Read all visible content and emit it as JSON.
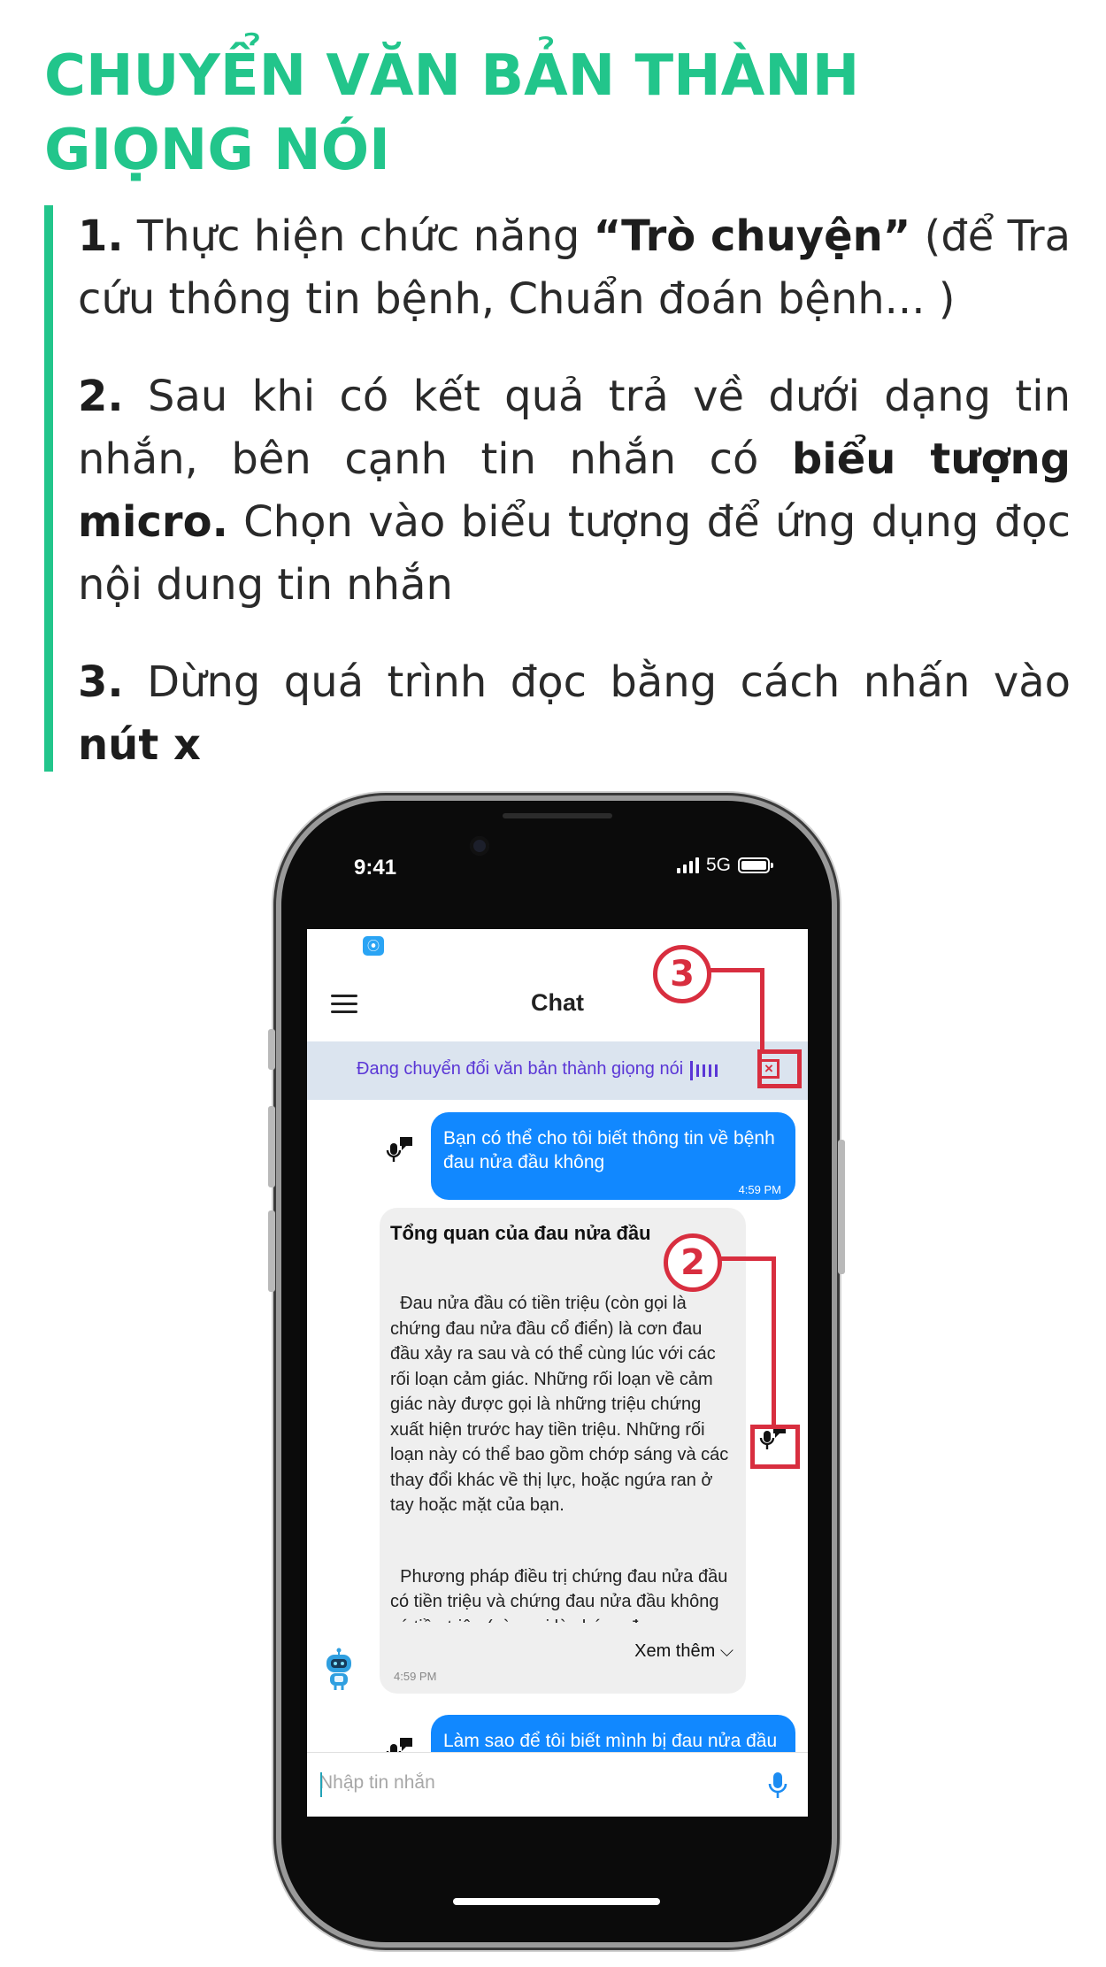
{
  "heading": "CHUYỂN VĂN BẢN THÀNH GIỌNG NÓI",
  "steps": {
    "s1": {
      "num": "1.",
      "pre": " Thực hiện chức năng ",
      "bold": "“Trò chuyện”",
      "post": " (để Tra cứu thông tin bệnh, Chuẩn đoán bệnh... )"
    },
    "s2": {
      "num": "2.",
      "pre": " Sau khi có kết quả trả về dưới dạng tin nhắn, bên cạnh tin nhắn có ",
      "bold": "biểu tượng micro.",
      "post": " Chọn vào biểu tượng để ứng dụng đọc nội dung tin nhắn"
    },
    "s3": {
      "num": "3.",
      "pre": " Dừng quá trình đọc bằng cách nhấn vào ",
      "bold": "nút x",
      "post": ""
    }
  },
  "phone": {
    "time": "9:41",
    "network": "5G",
    "app_icon": "radio-waves-icon",
    "chat_title": "Chat",
    "tts_status": "Đang chuyển đổi văn bản thành giọng nói",
    "close_glyph": "×",
    "messages": {
      "user1": {
        "text": "Bạn có thể cho tôi biết thông tin về bệnh đau nửa đầu không",
        "time": "4:59 PM"
      },
      "bot1": {
        "title": "Tổng quan của đau nửa đầu",
        "para1": "Đau nửa đầu có tiền triệu (còn gọi là chứng đau nửa đầu cổ điển) là cơn đau đầu xảy ra sau và có thể cùng lúc với các rối loạn cảm giác. Những rối loạn về cảm giác này được gọi là những triệu chứng xuất hiện trước hay tiền triệu. Những rối loạn này có thể bao gồm chớp sáng và các thay đổi khác về thị lực, hoặc ngứa ran ở tay hoặc mặt của bạn.",
        "para2": "Phương pháp điều trị chứng đau nửa đầu có tiền triệu và chứng đau nửa đầu không có tiền triệu (còn gọi là chứng đau",
        "more": "Xem thêm",
        "time": "4:59 PM"
      },
      "user2": {
        "text": "Làm sao để tôi biết mình bị đau nửa đầu"
      }
    },
    "input_placeholder": "Nhập tin nhắn"
  },
  "annotations": {
    "a2": "2",
    "a3": "3"
  },
  "colors": {
    "accent_green": "#22c58b",
    "callout_red": "#d82e3f",
    "user_bubble": "#1188ff",
    "tts_purple": "#5a36d6"
  }
}
